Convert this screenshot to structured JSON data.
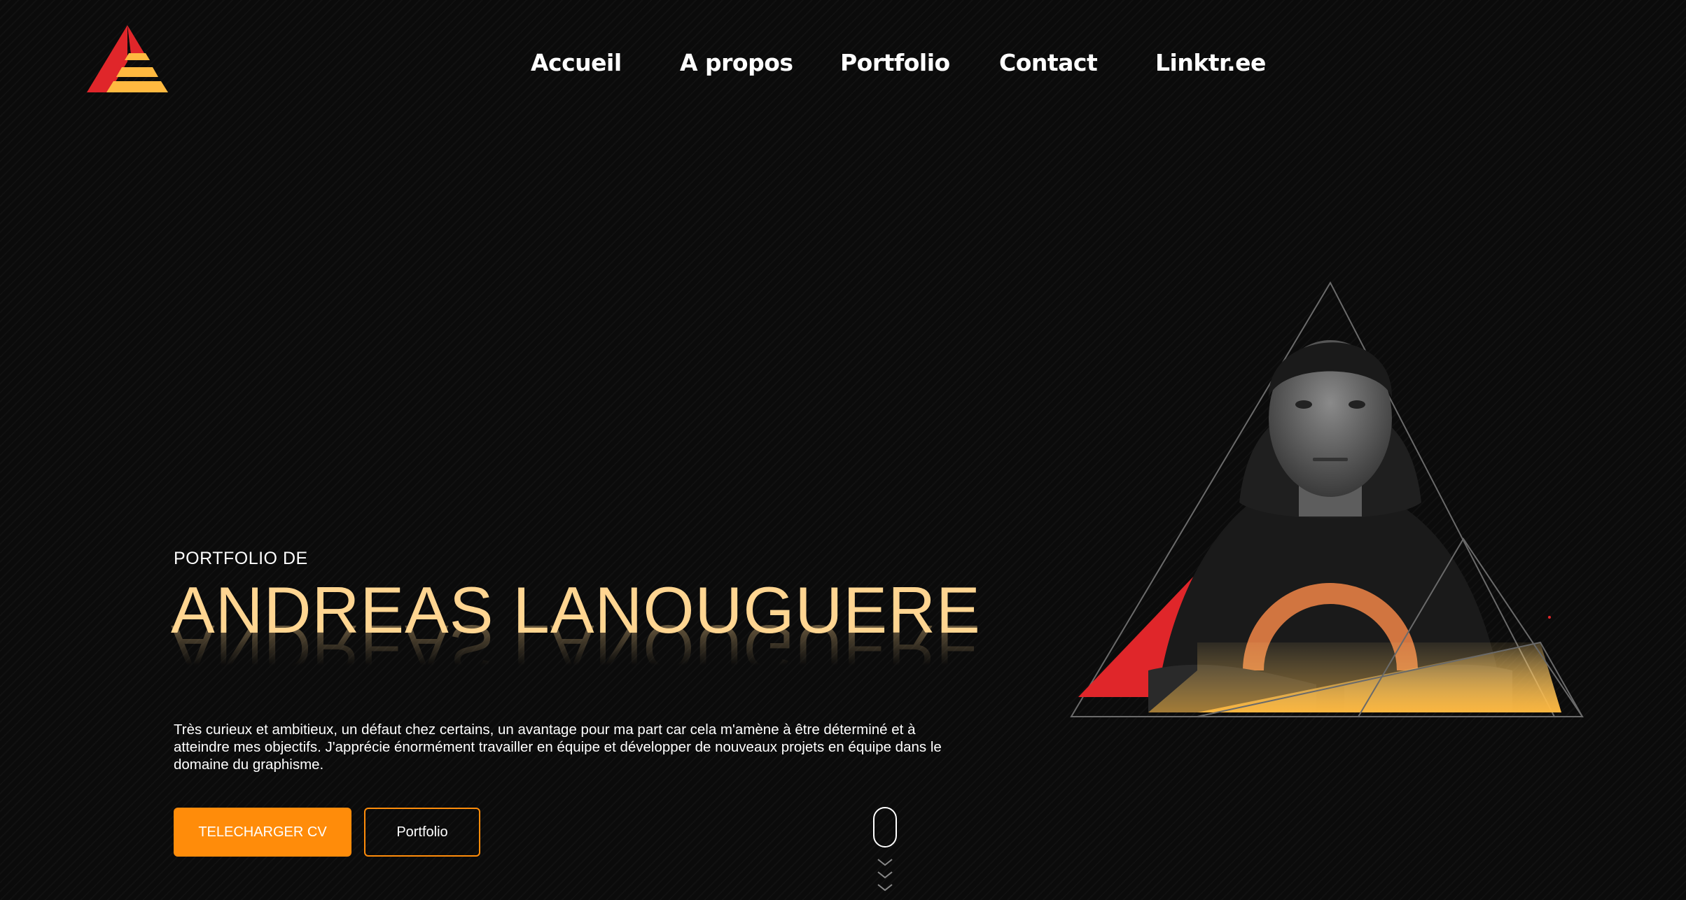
{
  "brand": {
    "logo_icon": "triangle-logo-icon",
    "colors": {
      "red": "#e0262a",
      "orange": "#ff8c0a",
      "gold": "#ffb940"
    }
  },
  "nav": {
    "items": [
      {
        "label": "Accueil"
      },
      {
        "label": "A propos"
      },
      {
        "label": "Portfolio"
      },
      {
        "label": "Contact"
      },
      {
        "label": "Linktr.ee"
      }
    ]
  },
  "hero": {
    "eyebrow": "PORTFOLIO DE",
    "name": "ANDREAS LANOUGUERE",
    "description": "Très curieux et ambitieux, un défaut chez certains, un avantage pour ma part car cela m'amène à être déterminé et à atteindre mes objectifs. J'apprécie énormément travailler en équipe et développer de nouveaux projets en équipe dans le domaine du graphisme.",
    "cta_primary": "TELECHARGER CV",
    "cta_secondary": "Portfolio",
    "name_color": "#ffd591"
  },
  "scroll_indicator": {
    "icon": "mouse-scroll-icon"
  },
  "portrait": {
    "icon": "portrait-photo"
  }
}
